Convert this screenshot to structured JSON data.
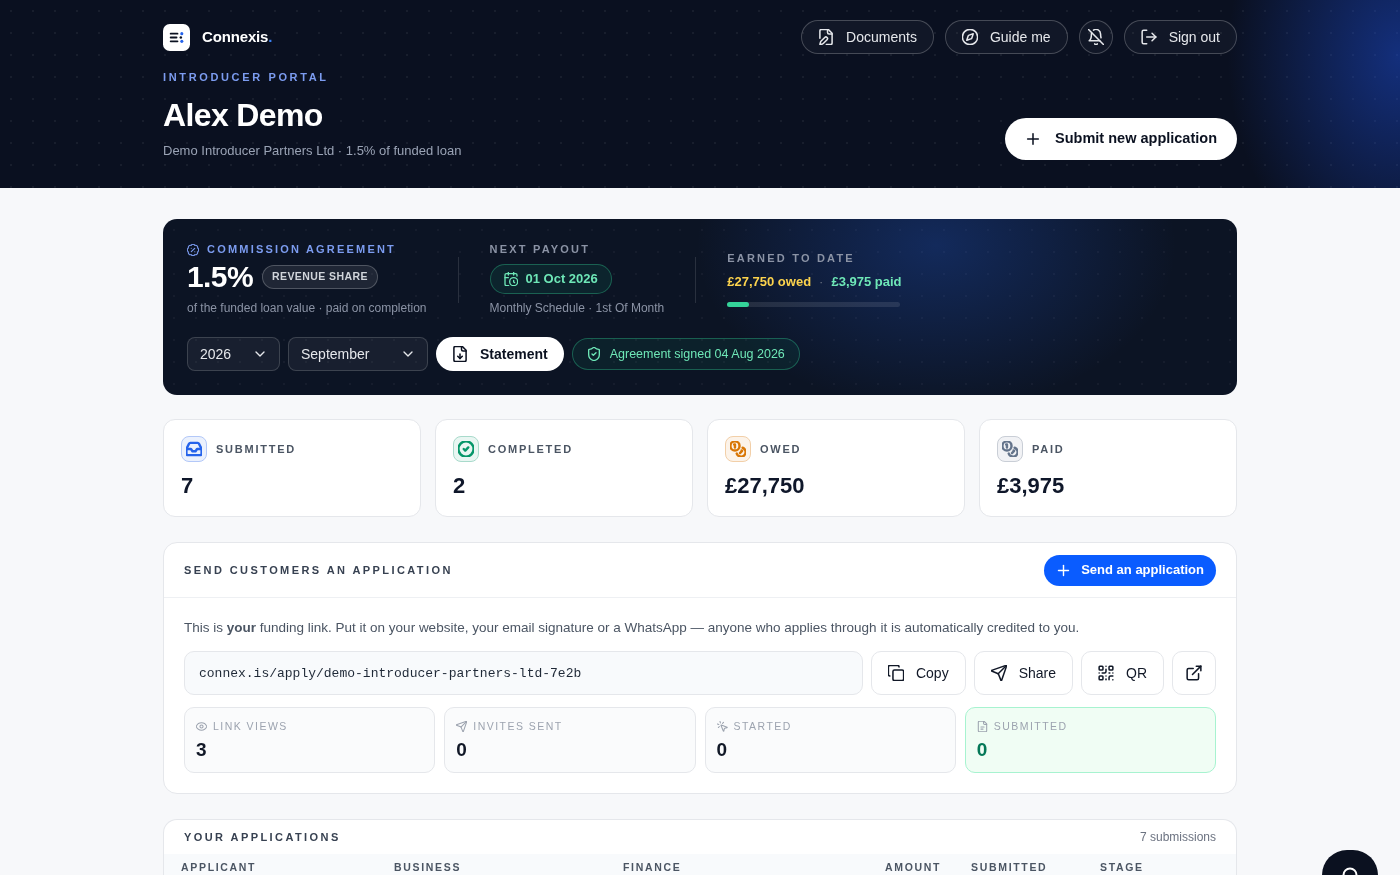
{
  "brand": {
    "name": "Connexis",
    "mark": "."
  },
  "nav_buttons": [
    {
      "kind": "documents",
      "label": "Documents"
    },
    {
      "kind": "guide",
      "label": "Guide me"
    },
    {
      "kind": "notifications-off"
    },
    {
      "kind": "sign-out",
      "label": "Sign out"
    }
  ],
  "hero": {
    "eyebrow": "INTRODUCER PORTAL",
    "title": "Alex Demo",
    "subtitle": "Demo Introducer Partners Ltd · 1.5% of funded loan",
    "action": "Submit new application"
  },
  "commission": {
    "label": "COMMISSION AGREEMENT",
    "rate": "1.5%",
    "rate_tag": "REVENUE SHARE",
    "rate_note": "of the funded loan value · paid on completion",
    "next_payout": {
      "label": "NEXT PAYOUT",
      "date": "01 Oct 2026",
      "note": "Monthly Schedule · 1st Of Month"
    },
    "earned": {
      "label": "EARNED TO DATE",
      "owed": "£27,750 owed",
      "separator": "·",
      "paid": "£3,975 paid",
      "level": 0.125
    },
    "year": "2026",
    "month": "September",
    "statement": "Statement",
    "agreement": "Agreement signed 04 Aug 2026"
  },
  "stats": [
    {
      "kind": "inbox",
      "label": "SUBMITTED",
      "value": "7",
      "color": "#2563eb"
    },
    {
      "kind": "check",
      "label": "COMPLETED",
      "value": "2",
      "color": "#059669"
    },
    {
      "kind": "coins",
      "label": "OWED",
      "value": "£27,750",
      "color": "#d97706"
    },
    {
      "kind": "coins",
      "label": "PAID",
      "value": "£3,975",
      "color": "#64748b"
    }
  ],
  "send": {
    "title": "SEND CUSTOMERS AN APPLICATION",
    "action": "Send an application",
    "intro": "This is **your** funding link. Put it on your website, your email signature or a WhatsApp — anyone who applies through it is automatically credited to you.",
    "link": "connex.is/apply/demo-introducer-partners-ltd-7e2b",
    "link_actions": [
      {
        "kind": "copy",
        "label": "Copy"
      },
      {
        "kind": "share",
        "label": "Share"
      },
      {
        "kind": "qr",
        "label": "QR"
      },
      {
        "kind": "external"
      }
    ],
    "metrics": [
      {
        "kind": "eye",
        "label": "LINK VIEWS",
        "value": "3",
        "highlighted": false
      },
      {
        "kind": "send",
        "label": "INVITES SENT",
        "value": "0",
        "highlighted": false
      },
      {
        "kind": "pointer",
        "label": "STARTED",
        "value": "0",
        "highlighted": false
      },
      {
        "kind": "file",
        "label": "SUBMITTED",
        "value": "0",
        "highlighted": true
      }
    ]
  },
  "applications": {
    "title": "YOUR APPLICATIONS",
    "count": "7 submissions",
    "columns": [
      "APPLICANT",
      "BUSINESS",
      "FINANCE",
      "AMOUNT",
      "SUBMITTED",
      "STAGE"
    ]
  }
}
